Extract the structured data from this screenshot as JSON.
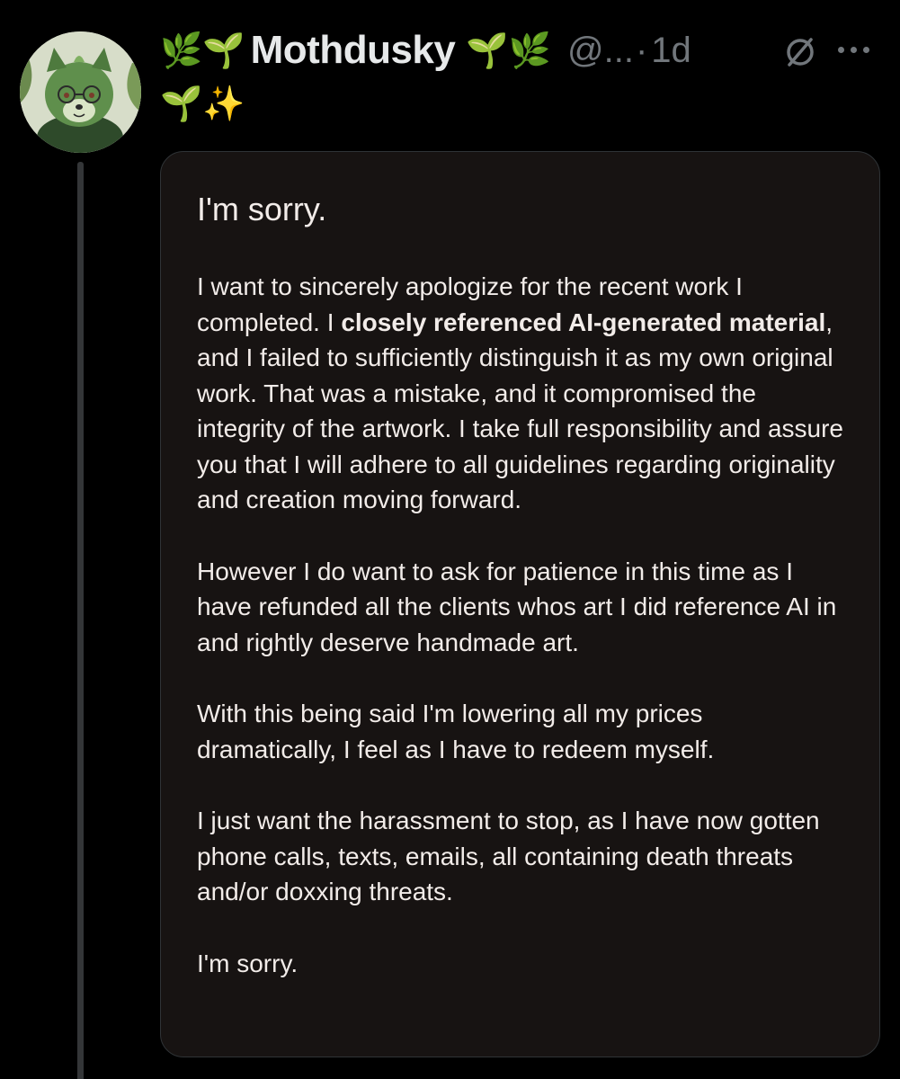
{
  "post": {
    "display_name": "Mothdusky",
    "name_prefix_emoji": "🌿🌱",
    "name_suffix_emoji": "🌱🌿",
    "name_line2_emoji": "🌱✨",
    "handle": "@...",
    "separator": "·",
    "timestamp": "1d"
  },
  "icons": {
    "avatar": "avatar-image",
    "edit": "edit-slash-icon",
    "more": "more-options-icon"
  },
  "image_text": {
    "title": "I'm sorry.",
    "p1_before_bold": "I want to sincerely apologize for the recent work I completed. I ",
    "p1_bold": "closely referenced AI-generated material",
    "p1_after_bold": ", and I failed to sufficiently distinguish it as my own original work. That was a mistake, and it compromised the integrity of the artwork. I take full responsibility and assure you that I will adhere to all guidelines regarding originality and creation moving forward.",
    "p2": "However I do want to ask for patience in this time as I have refunded all the clients whos art I did reference AI in and rightly deserve handmade art.",
    "p3": "With this being said I'm lowering all my prices dramatically, I feel as I have to redeem myself.",
    "p4": "I just want the harassment to stop, as I have now gotten phone calls, texts, emails, all containing death threats and/or doxxing threats.",
    "closing": "I'm sorry."
  },
  "colors": {
    "background": "#000000",
    "card_background": "#171312",
    "muted_text": "#71767b",
    "name_text": "#e7e9ea"
  }
}
